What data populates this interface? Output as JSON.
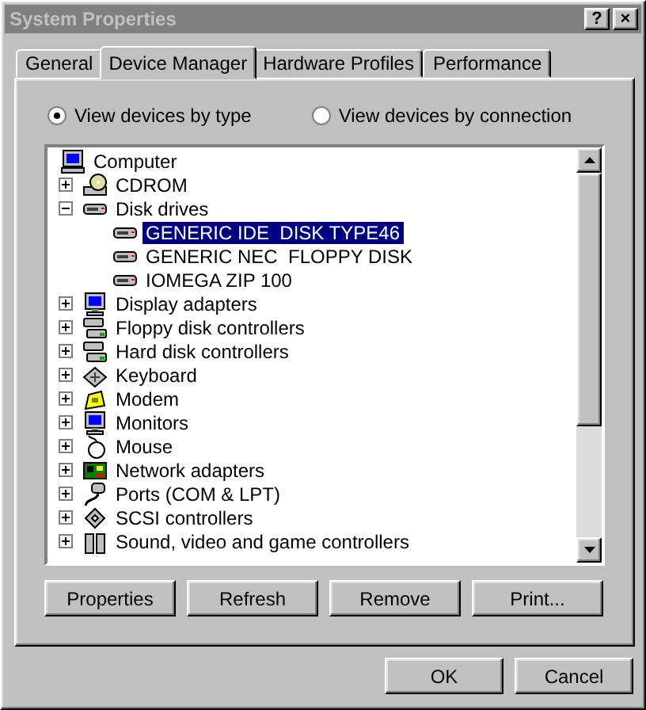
{
  "window": {
    "title": "System Properties",
    "controls": [
      "?",
      "×"
    ]
  },
  "tabs": [
    {
      "label": "General",
      "selected": false
    },
    {
      "label": "Device Manager",
      "selected": true
    },
    {
      "label": "Hardware Profiles",
      "selected": false
    },
    {
      "label": "Performance",
      "selected": false
    }
  ],
  "view_options": [
    {
      "label": "View devices by type",
      "selected": true
    },
    {
      "label": "View devices by connection",
      "selected": false
    }
  ],
  "tree": {
    "label": "Computer",
    "kind": "computer",
    "selected": false,
    "children": [
      {
        "label": "CDROM",
        "kind": "cdrom",
        "selected": false,
        "expanded": false
      },
      {
        "label": "Disk drives",
        "kind": "disk",
        "selected": false,
        "expanded": true,
        "children": [
          {
            "label": "GENERIC IDE  DISK TYPE46",
            "kind": "disk",
            "selected": true
          },
          {
            "label": "GENERIC NEC  FLOPPY DISK",
            "kind": "disk",
            "selected": false
          },
          {
            "label": "IOMEGA ZIP 100",
            "kind": "disk",
            "selected": false
          }
        ]
      },
      {
        "label": "Display adapters",
        "kind": "monitor",
        "selected": false,
        "expanded": false
      },
      {
        "label": "Floppy disk controllers",
        "kind": "controller",
        "selected": false,
        "expanded": false
      },
      {
        "label": "Hard disk controllers",
        "kind": "controller",
        "selected": false,
        "expanded": false
      },
      {
        "label": "Keyboard",
        "kind": "keyboard",
        "selected": false,
        "expanded": false
      },
      {
        "label": "Modem",
        "kind": "modem",
        "selected": false,
        "expanded": false
      },
      {
        "label": "Monitors",
        "kind": "monitor",
        "selected": false,
        "expanded": false
      },
      {
        "label": "Mouse",
        "kind": "mouse",
        "selected": false,
        "expanded": false
      },
      {
        "label": "Network adapters",
        "kind": "network",
        "selected": false,
        "expanded": false
      },
      {
        "label": "Ports (COM & LPT)",
        "kind": "port",
        "selected": false,
        "expanded": false
      },
      {
        "label": "SCSI controllers",
        "kind": "scsi",
        "selected": false,
        "expanded": false
      },
      {
        "label": "Sound, video and game controllers",
        "kind": "sound",
        "selected": false,
        "expanded": false
      }
    ]
  },
  "actions": [
    "Properties",
    "Refresh",
    "Remove",
    "Print..."
  ],
  "buttons": [
    "OK",
    "Cancel"
  ]
}
